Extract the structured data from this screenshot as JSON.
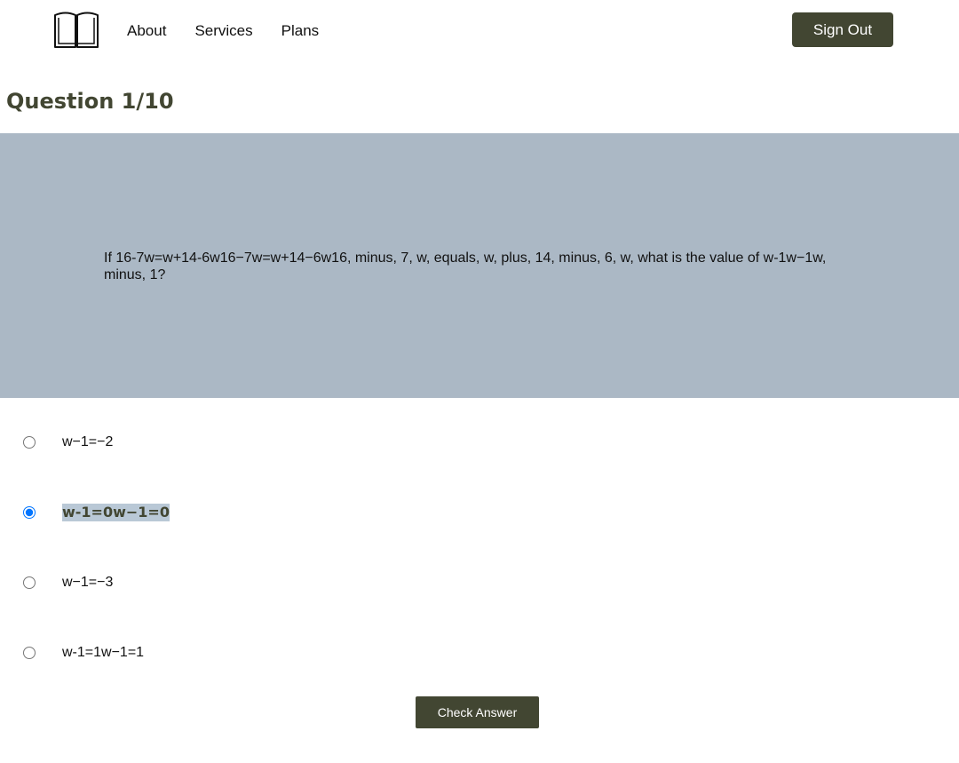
{
  "header": {
    "logo_icon": "open-book-icon",
    "nav": [
      {
        "label": "About"
      },
      {
        "label": "Services"
      },
      {
        "label": "Plans"
      }
    ],
    "sign_out_label": "Sign Out"
  },
  "question": {
    "title": "Question 1/10",
    "text": "If 16-7w=w+14-6w16−7w=w+14−6w16, minus, 7, w, equals, w, plus, 14, minus, 6, w, what is the value of w-1w−1w, minus, 1?"
  },
  "options": [
    {
      "label": "w−1=−2",
      "selected": false
    },
    {
      "label": "w-1=0w−1=0",
      "selected": true
    },
    {
      "label": "w−1=−3",
      "selected": false
    },
    {
      "label": "w-1=1w−1=1",
      "selected": false
    }
  ],
  "check_answer_label": "Check Answer",
  "colors": {
    "accent": "#424632",
    "panel": "#abb8c5",
    "selection_highlight": "#b9c8d6"
  }
}
